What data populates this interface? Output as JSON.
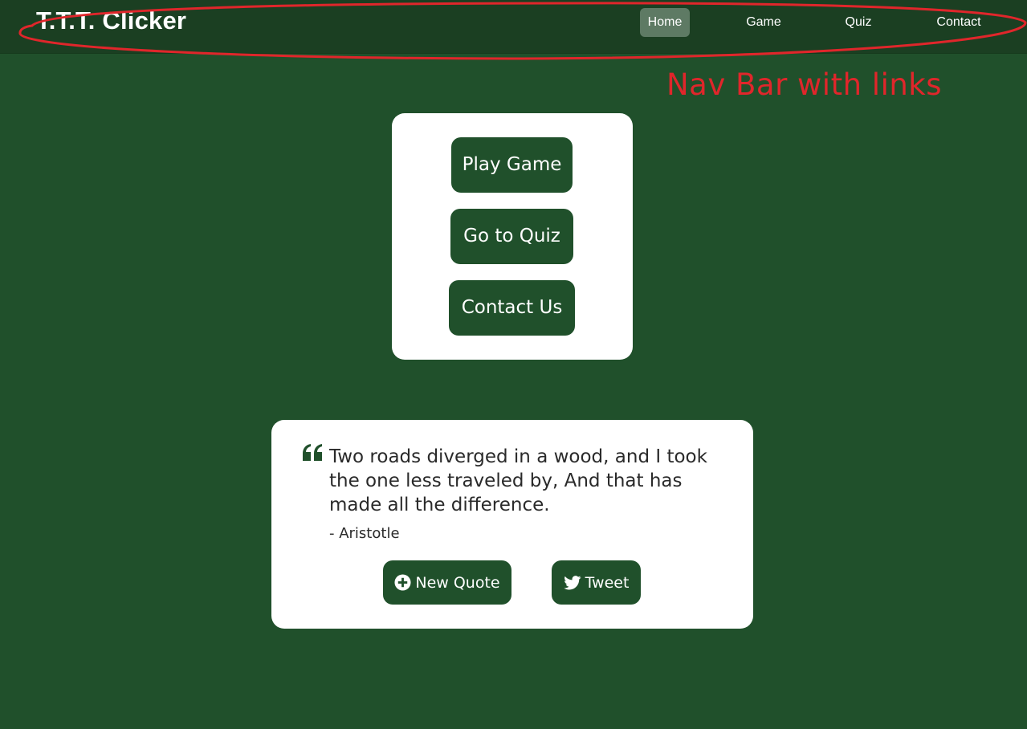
{
  "navbar": {
    "brand": "T.T.T. Clicker",
    "links": [
      {
        "label": "Home",
        "active": true
      },
      {
        "label": "Game",
        "active": false
      },
      {
        "label": "Quiz",
        "active": false
      },
      {
        "label": "Contact",
        "active": false
      }
    ]
  },
  "annotation": {
    "label": "Nav Bar with links",
    "color": "#e0262b"
  },
  "menu": {
    "buttons": [
      {
        "label": "Play Game"
      },
      {
        "label": "Go to Quiz"
      },
      {
        "label": "Contact Us"
      }
    ]
  },
  "quote": {
    "text": "Two roads diverged in a wood, and I took the one less traveled by, And that has made all the difference.",
    "author": "- Aristotle",
    "new_quote_label": "New Quote",
    "tweet_label": "Tweet"
  },
  "icons": {
    "quote": "quote-icon",
    "new_quote": "plus-circle-icon",
    "tweet": "twitter-icon"
  },
  "colors": {
    "background": "#20502b",
    "navbar": "#1b3f22",
    "active_link": "#5e7a64",
    "button": "#20502b",
    "card": "#ffffff"
  }
}
